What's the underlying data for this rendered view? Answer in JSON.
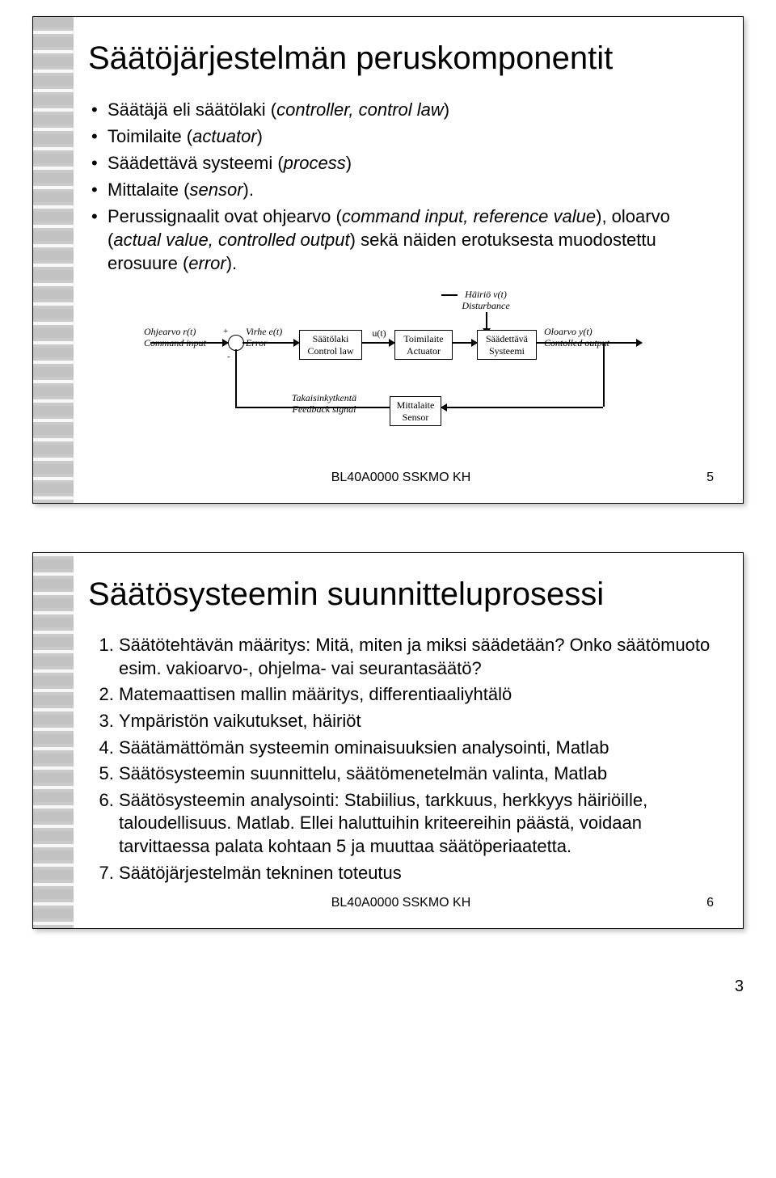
{
  "page_corner_number": "3",
  "slide1": {
    "title": "Säätöjärjestelmän peruskomponentit",
    "bullets": [
      "Säätäjä eli säätölaki (<i>controller, control law</i>)",
      "Toimilaite (<i>actuator</i>)",
      "Säädettävä systeemi (<i>process</i>)",
      "Mittalaite (<i>sensor</i>).",
      "Perussignaalit ovat ohjearvo (<i>command input, reference value</i>), oloarvo (<i>actual value, controlled output</i>) sekä näiden erotuksesta muodostettu erosuure (<i>error</i>)."
    ],
    "diagram": {
      "ref_top": "Ohjearvo  r(t)",
      "ref_bot": "Command input",
      "err_top": "Virhe  e(t)",
      "err_bot": "Error",
      "ctrl_top": "Säätölaki",
      "ctrl_bot": "Control law",
      "u": "u(t)",
      "act_top": "Toimilaite",
      "act_bot": "Actuator",
      "dist_top": "Häiriö v(t)",
      "dist_bot": "Disturbance",
      "proc_top": "Säädettävä",
      "proc_bot": "Systeemi",
      "out_top": "Oloarvo  y(t)",
      "out_bot": "Contolled output",
      "fb_top": "Takaisinkytkentä",
      "fb_bot": "Feedback signal",
      "sens_top": "Mittalaite",
      "sens_bot": "Sensor",
      "plus": "+",
      "minus": "-"
    },
    "footer_code": "BL40A0000 SSKMO KH",
    "footer_num": "5"
  },
  "slide2": {
    "title": "Säätösysteemin suunnitteluprosessi",
    "items": [
      "Säätötehtävän määritys: Mitä, miten ja miksi säädetään? Onko säätömuoto esim. vakioarvo-, ohjelma- vai seurantasäätö?",
      "Matemaattisen mallin määritys, differentiaaliyhtälö",
      "Ympäristön vaikutukset, häiriöt",
      "Säätämättömän systeemin ominaisuuksien analysointi, Matlab",
      "Säätösysteemin suunnittelu, säätömenetelmän valinta, Matlab",
      "Säätösysteemin analysointi: Stabiilius, tarkkuus, herkkyys häiriöille, taloudellisuus. Matlab. Ellei haluttuihin kriteereihin päästä, voidaan tarvittaessa palata kohtaan 5 ja muuttaa säätöperiaatetta.",
      "Säätöjärjestelmän tekninen toteutus"
    ],
    "footer_code": "BL40A0000 SSKMO KH",
    "footer_num": "6"
  }
}
